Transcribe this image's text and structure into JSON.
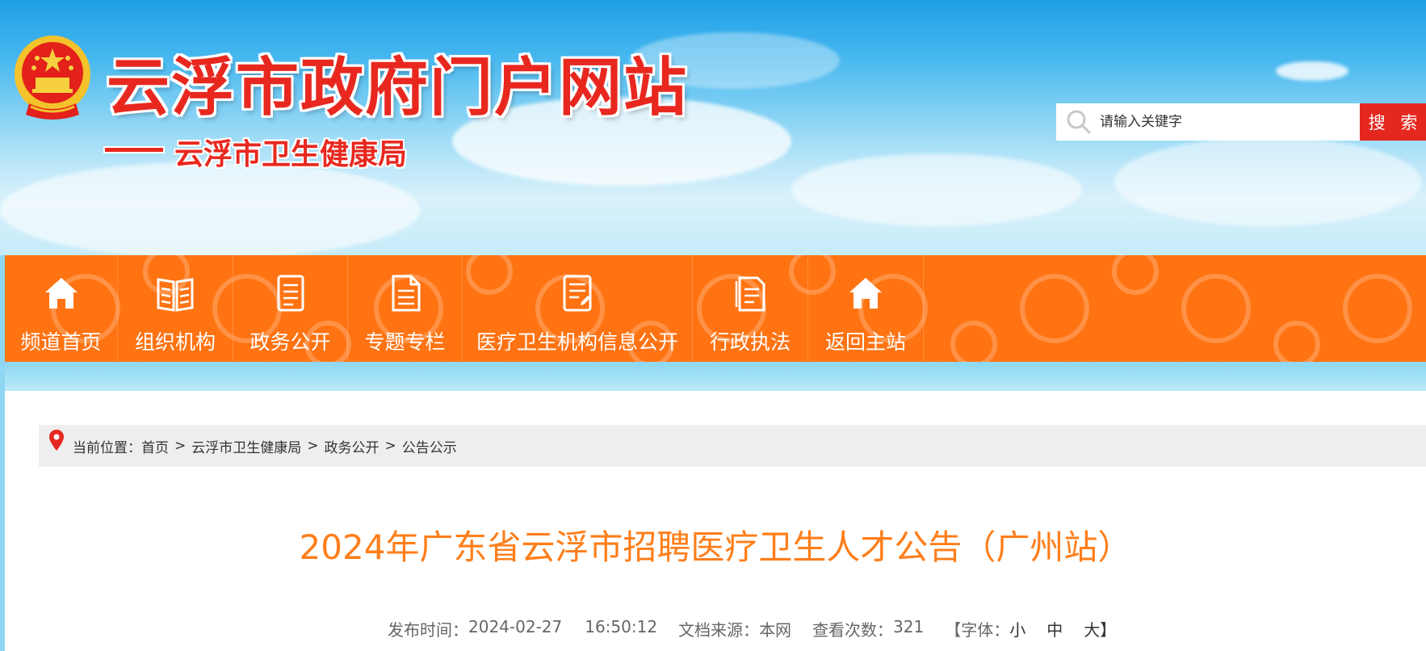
{
  "header": {
    "site_title": "云浮市政府门户网站",
    "sub_title": "云浮市卫生健康局",
    "search": {
      "placeholder": "请输入关键字",
      "button_label": "搜 索"
    }
  },
  "nav": {
    "items": [
      {
        "label": "频道首页",
        "icon": "home-icon"
      },
      {
        "label": "组织机构",
        "icon": "book-icon"
      },
      {
        "label": "政务公开",
        "icon": "document-icon"
      },
      {
        "label": "专题专栏",
        "icon": "file-icon"
      },
      {
        "label": "医疗卫生机构信息公开",
        "icon": "form-icon"
      },
      {
        "label": "行政执法",
        "icon": "report-icon"
      },
      {
        "label": "返回主站",
        "icon": "home-icon"
      }
    ]
  },
  "breadcrumb": {
    "prefix": "当前位置：",
    "items": [
      "首页",
      "云浮市卫生健康局",
      "政务公开",
      "公告公示"
    ],
    "separator": ">"
  },
  "article": {
    "title": "2024年广东省云浮市招聘医疗卫生人才公告（广州站）",
    "publish_label": "发布时间：",
    "publish_date": "2024-02-27",
    "publish_time": "16:50:12",
    "source_label": "文档来源：",
    "source": "本网",
    "views_label": "查看次数：",
    "views": "321",
    "font_label": "【字体：",
    "font_small": "小",
    "font_medium": "中",
    "font_large": "大",
    "font_end": "】"
  },
  "colors": {
    "nav_orange": "#ff7312",
    "title_orange": "#ff7e1a",
    "brand_red": "#e8281f",
    "search_red": "#e5281f"
  }
}
